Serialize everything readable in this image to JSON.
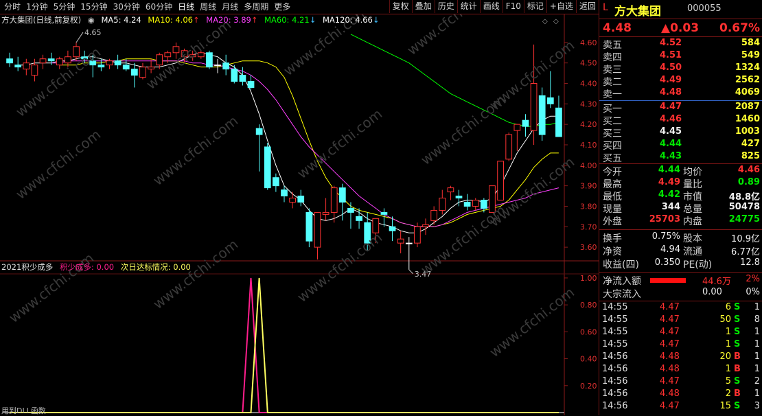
{
  "toolbar": {
    "periods": [
      "分时",
      "1分钟",
      "5分钟",
      "15分钟",
      "30分钟",
      "60分钟",
      "日线",
      "周线",
      "月线",
      "多周期",
      "更多"
    ],
    "active_period": "日线",
    "buttons": [
      "复权",
      "叠加",
      "历史",
      "统计",
      "画线",
      "F10",
      "标记",
      "+自选",
      "返回"
    ]
  },
  "chart_header": {
    "title": "方大集团(日线,前复权)",
    "ma5": "MA5: 4.24",
    "ma10": "MA10: 4.06",
    "ma20": "MA20: 3.89",
    "ma60": "MA60: 4.21",
    "ma120": "MA120: 4.66",
    "arrow_up": "↑",
    "arrow_down": "↓",
    "colors": {
      "ma5": "#ffffff",
      "ma10": "#ffff00",
      "ma20": "#ff40ff",
      "ma60": "#00ff00",
      "ma120": "#ffffff"
    }
  },
  "annotations": {
    "high_label": "4.65",
    "low_label": "3.47"
  },
  "indicator_header": {
    "name": "2021积少成多",
    "line1": "积少成多: 0.00",
    "line2": "次日达标情况: 0.00"
  },
  "bottom_left_text": "用到DLL函数",
  "watermark": "www.cfchi.com",
  "chart_data": [
    {
      "type": "candlestick",
      "title": "方大集团(日线,前复权)",
      "y_ticks": [
        "4.60",
        "4.50",
        "4.40",
        "4.30",
        "4.20",
        "4.10",
        "4.00",
        "3.90",
        "3.80",
        "3.70",
        "3.60"
      ],
      "ylim": [
        3.54,
        4.68
      ],
      "candles": [
        [
          4.52,
          4.55,
          4.48,
          4.5
        ],
        [
          4.49,
          4.53,
          4.46,
          4.48
        ],
        [
          4.47,
          4.52,
          4.44,
          4.5
        ],
        [
          4.44,
          4.52,
          4.41,
          4.49
        ],
        [
          4.5,
          4.54,
          4.47,
          4.52
        ],
        [
          4.52,
          4.55,
          4.49,
          4.51
        ],
        [
          4.49,
          4.53,
          4.47,
          4.52
        ],
        [
          4.5,
          4.56,
          4.48,
          4.53
        ],
        [
          4.53,
          4.6,
          4.51,
          4.58
        ],
        [
          4.53,
          4.56,
          4.5,
          4.52
        ],
        [
          4.51,
          4.54,
          4.43,
          4.49
        ],
        [
          4.49,
          4.52,
          4.46,
          4.48
        ],
        [
          4.49,
          4.52,
          4.47,
          4.51
        ],
        [
          4.51,
          4.54,
          4.47,
          4.49
        ],
        [
          4.49,
          4.52,
          4.46,
          4.47
        ],
        [
          4.47,
          4.5,
          4.38,
          4.44
        ],
        [
          4.43,
          4.5,
          4.42,
          4.48
        ],
        [
          4.47,
          4.52,
          4.45,
          4.48
        ],
        [
          4.49,
          4.55,
          4.47,
          4.54
        ],
        [
          4.53,
          4.56,
          4.5,
          4.55
        ],
        [
          4.55,
          4.6,
          4.52,
          4.58
        ],
        [
          4.53,
          4.57,
          4.5,
          4.56
        ],
        [
          4.53,
          4.56,
          4.51,
          4.54
        ],
        [
          4.53,
          4.56,
          4.52,
          4.55
        ],
        [
          4.55,
          4.56,
          4.47,
          4.48
        ],
        [
          4.49,
          4.52,
          4.45,
          4.49
        ],
        [
          4.5,
          4.54,
          4.44,
          4.47
        ],
        [
          4.47,
          4.49,
          4.4,
          4.41
        ],
        [
          4.44,
          4.48,
          4.39,
          4.41
        ],
        [
          4.41,
          4.44,
          4.37,
          4.38
        ],
        [
          4.18,
          4.2,
          3.97,
          4.15
        ],
        [
          4.09,
          4.11,
          3.88,
          3.89
        ],
        [
          3.94,
          3.96,
          3.87,
          3.9
        ],
        [
          3.88,
          3.9,
          3.82,
          3.85
        ],
        [
          3.82,
          3.87,
          3.79,
          3.84
        ],
        [
          3.85,
          3.88,
          3.8,
          3.82
        ],
        [
          3.77,
          3.79,
          3.6,
          3.63
        ],
        [
          3.6,
          3.77,
          3.54,
          3.77
        ],
        [
          3.76,
          3.84,
          3.73,
          3.77
        ],
        [
          3.77,
          3.9,
          3.72,
          3.89
        ],
        [
          3.89,
          3.91,
          3.73,
          3.82
        ],
        [
          3.79,
          3.82,
          3.69,
          3.77
        ],
        [
          3.75,
          3.79,
          3.69,
          3.73
        ],
        [
          3.72,
          3.77,
          3.58,
          3.62
        ],
        [
          3.67,
          3.74,
          3.62,
          3.74
        ],
        [
          3.77,
          3.79,
          3.7,
          3.76
        ],
        [
          3.7,
          3.75,
          3.63,
          3.68
        ],
        [
          3.62,
          3.68,
          3.57,
          3.64
        ],
        [
          3.62,
          3.65,
          3.49,
          3.62
        ],
        [
          3.62,
          3.72,
          3.6,
          3.7
        ],
        [
          3.7,
          3.74,
          3.66,
          3.71
        ],
        [
          3.73,
          3.8,
          3.71,
          3.78
        ],
        [
          3.78,
          3.88,
          3.76,
          3.84
        ],
        [
          3.87,
          3.9,
          3.83,
          3.89
        ],
        [
          3.85,
          3.88,
          3.8,
          3.84
        ],
        [
          3.82,
          3.86,
          3.78,
          3.8
        ],
        [
          3.8,
          3.84,
          3.78,
          3.83
        ],
        [
          3.83,
          3.84,
          3.77,
          3.79
        ],
        [
          3.77,
          3.85,
          3.77,
          3.9
        ],
        [
          3.83,
          4.02,
          3.83,
          4.02
        ],
        [
          4.03,
          4.16,
          4.02,
          4.15
        ],
        [
          4.17,
          4.2,
          4.07,
          4.2
        ],
        [
          4.22,
          4.25,
          4.14,
          4.19
        ],
        [
          4.17,
          4.59,
          4.1,
          4.4
        ],
        [
          4.34,
          4.38,
          4.12,
          4.15
        ],
        [
          4.33,
          4.46,
          4.28,
          4.3
        ],
        [
          4.28,
          4.34,
          4.17,
          4.14
        ]
      ],
      "ma": {
        "MA5": {
          "color": "#ffffff",
          "values": [
            4.49,
            4.49,
            4.5,
            4.5,
            4.5,
            4.51,
            4.51,
            4.52,
            4.53,
            4.53,
            4.52,
            4.51,
            4.5,
            4.5,
            4.49,
            4.48,
            4.48,
            4.48,
            4.49,
            4.5,
            4.52,
            4.54,
            4.55,
            4.54,
            4.53,
            4.5,
            4.48,
            4.44,
            4.36,
            4.25,
            4.12,
            4.0,
            3.9,
            3.86,
            3.83,
            3.78,
            3.74,
            3.73,
            3.74,
            3.76,
            3.79,
            3.77,
            3.74,
            3.72,
            3.71,
            3.7,
            3.68,
            3.67,
            3.67,
            3.69,
            3.72,
            3.75,
            3.79,
            3.82,
            3.83,
            3.83,
            3.82,
            3.84,
            3.9,
            3.98,
            4.06,
            4.12,
            4.18,
            4.22,
            4.24,
            4.24
          ]
        },
        "MA10": {
          "color": "#ffff00",
          "values": [
            4.49,
            4.49,
            4.49,
            4.5,
            4.5,
            4.5,
            4.51,
            4.51,
            4.52,
            4.52,
            4.52,
            4.52,
            4.51,
            4.51,
            4.51,
            4.5,
            4.49,
            4.48,
            4.48,
            4.48,
            4.49,
            4.5,
            4.51,
            4.51,
            4.51,
            4.5,
            4.48,
            4.43,
            4.34,
            4.23,
            4.12,
            4.02,
            3.94,
            3.88,
            3.84,
            3.8,
            3.78,
            3.77,
            3.76,
            3.75,
            3.74,
            3.72,
            3.71,
            3.7,
            3.7,
            3.7,
            3.71,
            3.72,
            3.74,
            3.76,
            3.77,
            3.78,
            3.79,
            3.8,
            3.83,
            3.88,
            3.93,
            3.99,
            4.03,
            4.06,
            4.06
          ]
        },
        "MA20": {
          "color": "#ff40ff",
          "values": [
            4.5,
            4.5,
            4.51,
            4.51,
            4.51,
            4.51,
            4.51,
            4.51,
            4.51,
            4.51,
            4.51,
            4.51,
            4.51,
            4.51,
            4.51,
            4.51,
            4.51,
            4.5,
            4.5,
            4.49,
            4.49,
            4.48,
            4.47,
            4.46,
            4.44,
            4.41,
            4.37,
            4.32,
            4.26,
            4.2,
            4.14,
            4.09,
            4.05,
            4.01,
            3.97,
            3.93,
            3.89,
            3.85,
            3.82,
            3.79,
            3.76,
            3.74,
            3.72,
            3.71,
            3.7,
            3.7,
            3.7,
            3.71,
            3.73,
            3.75,
            3.77,
            3.78,
            3.79,
            3.8,
            3.81,
            3.82,
            3.83,
            3.84,
            3.86,
            3.87,
            3.88,
            3.89
          ]
        },
        "MA60": {
          "color": "#00ff00",
          "values": [
            4.64,
            4.62,
            4.6,
            4.58,
            4.56,
            4.54,
            4.52,
            4.5,
            4.47,
            4.44,
            4.41,
            4.38,
            4.35,
            4.33,
            4.31,
            4.29,
            4.27,
            4.25,
            4.23,
            4.21,
            4.2,
            4.19,
            4.19,
            4.2,
            4.2,
            4.21
          ]
        },
        "MA120": {
          "color": "#ffffff",
          "values": []
        }
      }
    },
    {
      "type": "line",
      "title": "2021积少成多",
      "y_ticks": [
        "1.00",
        "0.80",
        "0.60",
        "0.40",
        "0.20"
      ],
      "ylim": [
        0,
        1.02
      ],
      "series": [
        {
          "name": "积少成多",
          "color": "#ff1e8c",
          "points": [
            [
              0,
              0
            ],
            [
              28,
              0
            ],
            [
              29,
              1
            ],
            [
              30,
              0
            ],
            [
              66,
              0
            ]
          ]
        },
        {
          "name": "次日达标情况",
          "color": "#ffff60",
          "points": [
            [
              0,
              0
            ],
            [
              29,
              0
            ],
            [
              30,
              1
            ],
            [
              31,
              0
            ],
            [
              66,
              0
            ]
          ]
        }
      ]
    }
  ],
  "quote": {
    "prefix": "L",
    "name": "方大集团",
    "code": "000055",
    "price": "4.48",
    "change": "▲0.03",
    "pct": "0.67%",
    "asks": [
      {
        "label": "卖五",
        "price": "4.52",
        "vol": "584",
        "color": "red"
      },
      {
        "label": "卖四",
        "price": "4.51",
        "vol": "549",
        "color": "red"
      },
      {
        "label": "卖三",
        "price": "4.50",
        "vol": "1324",
        "color": "red"
      },
      {
        "label": "卖二",
        "price": "4.49",
        "vol": "2562",
        "color": "red"
      },
      {
        "label": "卖一",
        "price": "4.48",
        "vol": "4069",
        "color": "red"
      }
    ],
    "bids": [
      {
        "label": "买一",
        "price": "4.47",
        "vol": "2087",
        "color": "red"
      },
      {
        "label": "买二",
        "price": "4.46",
        "vol": "1460",
        "color": "red"
      },
      {
        "label": "买三",
        "price": "4.45",
        "vol": "1003",
        "color": "white"
      },
      {
        "label": "买四",
        "price": "4.44",
        "vol": "427",
        "color": "green"
      },
      {
        "label": "买五",
        "price": "4.43",
        "vol": "825",
        "color": "green"
      }
    ],
    "stats_left": [
      {
        "label": "今开",
        "value": "4.44",
        "color": "green"
      },
      {
        "label": "最高",
        "value": "4.49",
        "color": "red"
      },
      {
        "label": "最低",
        "value": "4.42",
        "color": "green"
      },
      {
        "label": "现量",
        "value": "344",
        "color": "white"
      },
      {
        "label": "外盘",
        "value": "25703",
        "color": "red"
      }
    ],
    "stats_right": [
      {
        "label": "均价",
        "value": "4.46",
        "color": "red"
      },
      {
        "label": "量比",
        "value": "0.89",
        "color": "green"
      },
      {
        "label": "市值",
        "value": "48.8亿",
        "color": "white"
      },
      {
        "label": "总量",
        "value": "50478",
        "color": "white"
      },
      {
        "label": "内盘",
        "value": "24775",
        "color": "green"
      }
    ],
    "fund_left": [
      {
        "label": "换手",
        "value": "0.75%"
      },
      {
        "label": "净资",
        "value": "4.94"
      },
      {
        "label": "收益(四)",
        "value": "0.350"
      }
    ],
    "fund_right": [
      {
        "label": "股本",
        "value": "10.9亿"
      },
      {
        "label": "流通",
        "value": "6.77亿"
      },
      {
        "label": "PE(动)",
        "value": "12.8"
      }
    ],
    "netflow": {
      "label": "净流入额",
      "value": "44.6万",
      "pct": "2%",
      "bar_fraction": 0.75
    },
    "block": {
      "label": "大宗流入",
      "value": "0.00",
      "pct": "0%"
    },
    "ticks": [
      {
        "time": "14:55",
        "price": "4.47",
        "vol": "6",
        "side": "S",
        "n": "1",
        "vcolor": "yellow"
      },
      {
        "time": "14:55",
        "price": "4.47",
        "vol": "50",
        "side": "S",
        "n": "8",
        "vcolor": "yellow"
      },
      {
        "time": "14:55",
        "price": "4.47",
        "vol": "1",
        "side": "S",
        "n": "1",
        "vcolor": "yellow"
      },
      {
        "time": "14:55",
        "price": "4.47",
        "vol": "1",
        "side": "S",
        "n": "1",
        "vcolor": "yellow"
      },
      {
        "time": "14:56",
        "price": "4.48",
        "vol": "20",
        "side": "B",
        "n": "1",
        "vcolor": "yellow"
      },
      {
        "time": "14:56",
        "price": "4.48",
        "vol": "1",
        "side": "B",
        "n": "1",
        "vcolor": "yellow"
      },
      {
        "time": "14:56",
        "price": "4.47",
        "vol": "5",
        "side": "S",
        "n": "2",
        "vcolor": "yellow"
      },
      {
        "time": "14:56",
        "price": "4.48",
        "vol": "2",
        "side": "B",
        "n": "1",
        "vcolor": "yellow"
      },
      {
        "time": "14:56",
        "price": "4.47",
        "vol": "15",
        "side": "S",
        "n": "3",
        "vcolor": "yellow"
      }
    ]
  }
}
